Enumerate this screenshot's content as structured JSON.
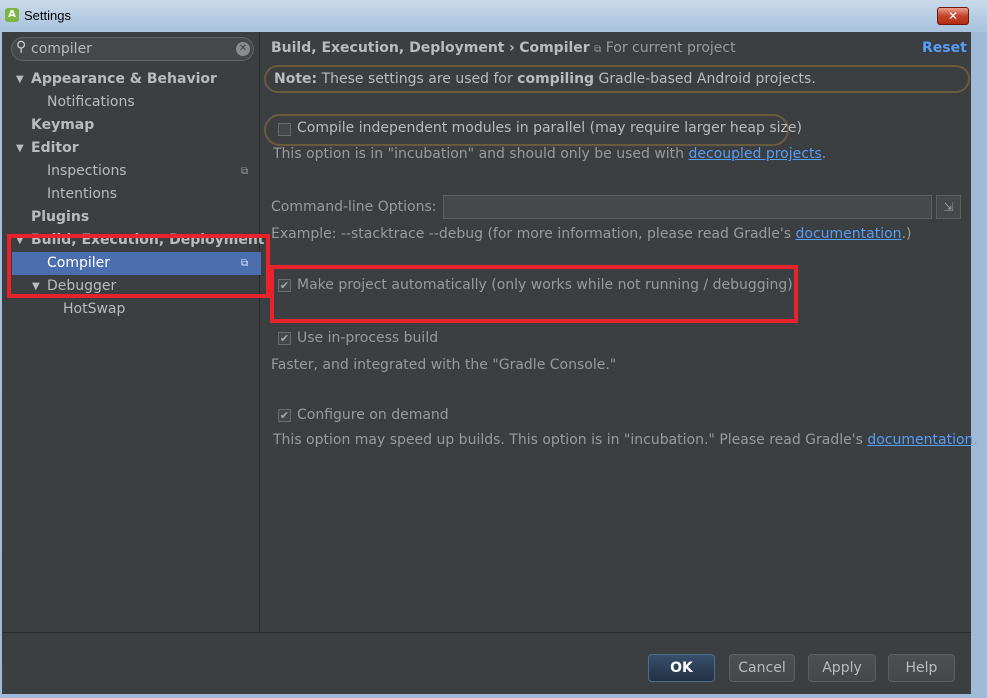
{
  "window": {
    "title": "Settings",
    "close_glyph": "✕"
  },
  "search": {
    "value": "compiler",
    "placeholder": ""
  },
  "sidebar": {
    "items": [
      {
        "label": "Appearance & Behavior"
      },
      {
        "label": "Notifications"
      },
      {
        "label": "Keymap"
      },
      {
        "label": "Editor"
      },
      {
        "label": "Inspections"
      },
      {
        "label": "Intentions"
      },
      {
        "label": "Plugins"
      },
      {
        "label": "Build, Execution, Deployment"
      },
      {
        "label": "Compiler"
      },
      {
        "label": "Debugger"
      },
      {
        "label": "HotSwap"
      }
    ]
  },
  "breadcrumb": {
    "section": "Build, Execution, Deployment",
    "separator": "›",
    "page": "Compiler",
    "scope": "For current project"
  },
  "reset_label": "Reset",
  "note": {
    "prefix": "Note:",
    "text1": " These settings are used for ",
    "bold": "compiling",
    "text2": " Gradle-based Android projects."
  },
  "options": {
    "parallel": {
      "label": "Compile independent modules in parallel (may require larger heap size)",
      "checked": false,
      "hint_pre": "This option is in \"incubation\" and should only be used with ",
      "hint_link": "decoupled projects",
      "hint_post": "."
    },
    "cmdline": {
      "label": "Command-line Options:",
      "value": "",
      "hint_pre": "Example: --stacktrace --debug (for more information, please read Gradle's ",
      "hint_link": "documentation",
      "hint_post": ".)"
    },
    "make_auto": {
      "label": "Make project automatically (only works while not running / debugging)",
      "checked": true
    },
    "in_process": {
      "label": "Use in-process build",
      "checked": true,
      "hint": "Faster, and integrated with the \"Gradle Console.\""
    },
    "on_demand": {
      "label": "Configure on demand",
      "checked": true,
      "hint_pre": "This option may speed up builds. This option is in \"incubation.\" Please read Gradle's ",
      "hint_link": "documentation",
      "hint_post": "."
    }
  },
  "buttons": {
    "ok": "OK",
    "cancel": "Cancel",
    "apply": "Apply",
    "help": "Help"
  },
  "colors": {
    "accent": "#589df6",
    "selection": "#4b6eaf",
    "highlight": "#e8232c"
  }
}
